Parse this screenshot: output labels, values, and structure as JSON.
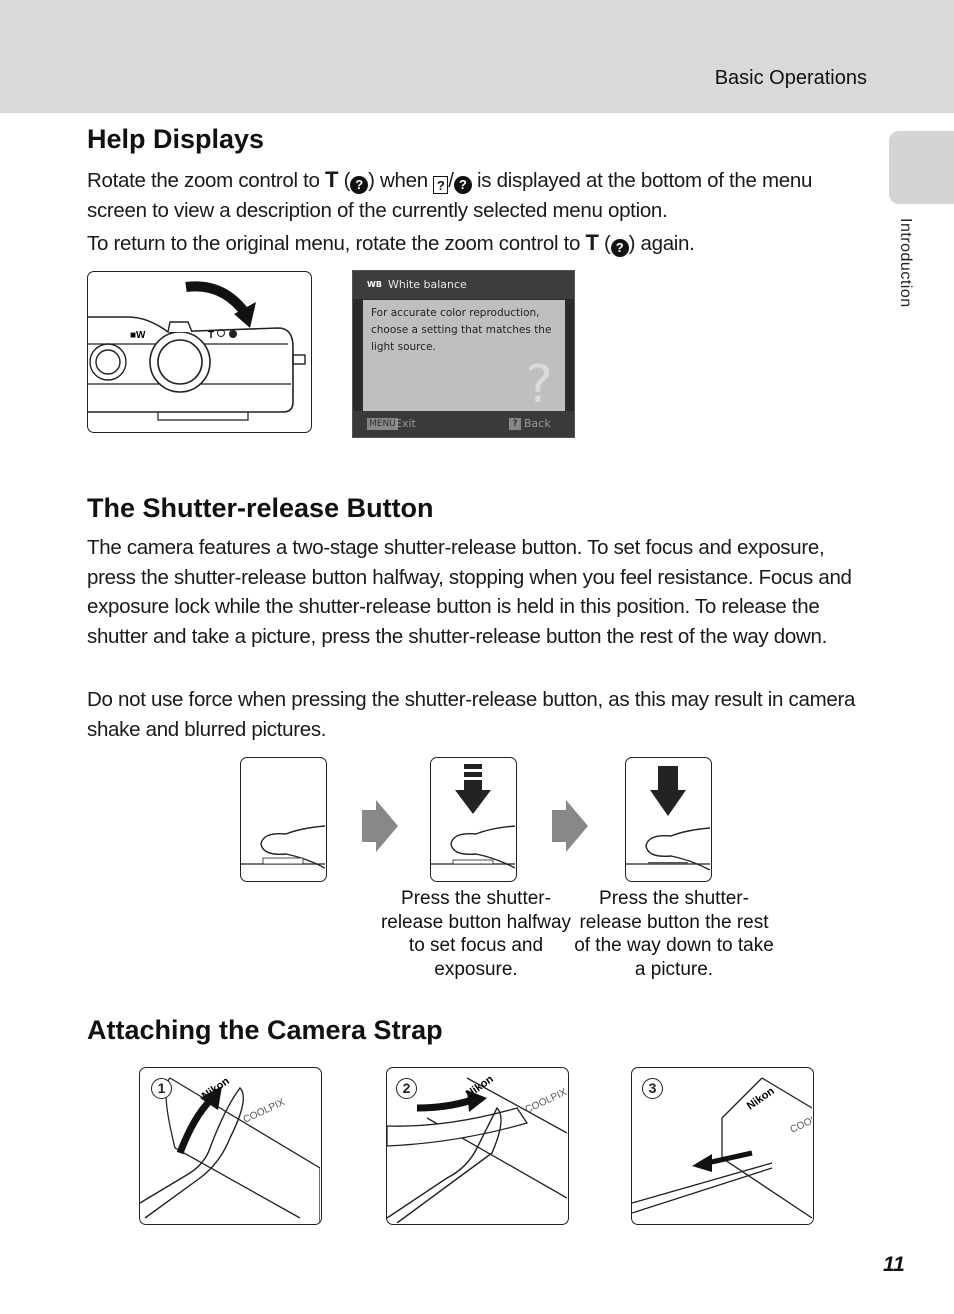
{
  "header": {
    "section_title": "Basic Operations"
  },
  "side_tab": {
    "label": "Introduction"
  },
  "help_displays": {
    "heading": "Help Displays",
    "para1_a": "Rotate the zoom control to ",
    "para1_T": "T",
    "para1_b": " (",
    "para1_c": ") when ",
    "para1_d": "/",
    "para1_e": " is displayed at the bottom of the menu screen to view a description of the currently selected menu option.",
    "para2_a": "To return to the original menu, rotate the zoom control to ",
    "para2_T": "T",
    "para2_b": " (",
    "para2_c": ") again.",
    "q_glyph": "?",
    "camera_figure": {
      "wide_label": "W",
      "tele_label": "T"
    },
    "lcd": {
      "icon_text": "WB",
      "title": "White balance",
      "body": "For accurate color reproduction, choose a setting that matches the light source.",
      "big_q": "?",
      "menu_key": "MENU",
      "exit_label": "Exit",
      "help_key": "?",
      "back_label": "Back"
    }
  },
  "shutter": {
    "heading": "The Shutter-release Button",
    "para1": "The camera features a two-stage shutter-release button. To set focus and exposure, press the shutter-release button halfway, stopping when you feel resistance. Focus and exposure lock while the shutter-release button is held in this position. To release the shutter and take a picture, press the shutter-release button the rest of the way down.",
    "para2": "Do not use force when pressing the shutter-release button, as this may result in camera shake and blurred pictures.",
    "captions": [
      "Press the shutter-release button halfway to set focus and exposure.",
      "Press the shutter-release button the rest of the way down to take a picture."
    ]
  },
  "strap": {
    "heading": "Attaching the Camera Strap",
    "steps": [
      {
        "number": "1",
        "brand": "Nikon",
        "model": "COOLPIX"
      },
      {
        "number": "2",
        "brand": "Nikon",
        "model": "COOLPIX"
      },
      {
        "number": "3",
        "brand": "Nikon",
        "model": "COOLPIX"
      }
    ]
  },
  "footer": {
    "page_number": "11"
  }
}
